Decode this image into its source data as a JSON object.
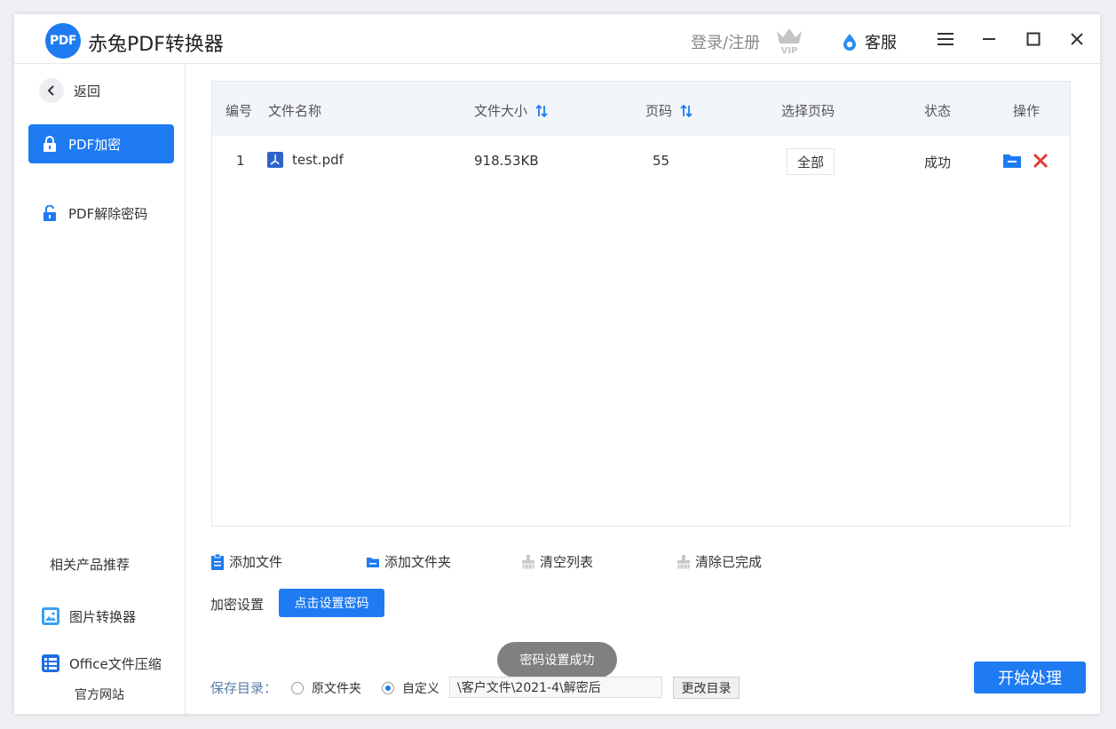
{
  "app": {
    "logo_text": "PDF",
    "title": "赤兔PDF转换器"
  },
  "header": {
    "login_label": "登录/注册",
    "vip_label": "VIP",
    "service_label": "客服"
  },
  "sidebar": {
    "back_label": "返回",
    "items": [
      {
        "label": "PDF加密",
        "active": true
      },
      {
        "label": "PDF解除密码",
        "active": false
      }
    ],
    "related_title": "相关产品推荐",
    "products": [
      {
        "label": "图片转换器"
      },
      {
        "label": "Office文件压缩"
      }
    ],
    "official_site": "官方网站"
  },
  "table": {
    "headers": {
      "no": "编号",
      "name": "文件名称",
      "size": "文件大小",
      "pages": "页码",
      "select_pages": "选择页码",
      "status": "状态",
      "ops": "操作"
    },
    "rows": [
      {
        "no": "1",
        "name": "test.pdf",
        "size": "918.53KB",
        "pages": "55",
        "select_pages": "全部",
        "status": "成功"
      }
    ]
  },
  "toolbar": {
    "add_file": "添加文件",
    "add_folder": "添加文件夹",
    "clear_list": "清空列表",
    "clear_done": "清除已完成"
  },
  "encrypt": {
    "label": "加密设置",
    "button": "点击设置密码"
  },
  "toast": "密码设置成功",
  "save": {
    "label": "保存目录：",
    "option_original": "原文件夹",
    "option_custom": "自定义",
    "selected": "自定义",
    "path": "\\客户文件\\2021-4\\解密后",
    "change_button": "更改目录"
  },
  "start_button": "开始处理",
  "colors": {
    "accent": "#1e7bf2",
    "danger": "#e53935"
  }
}
